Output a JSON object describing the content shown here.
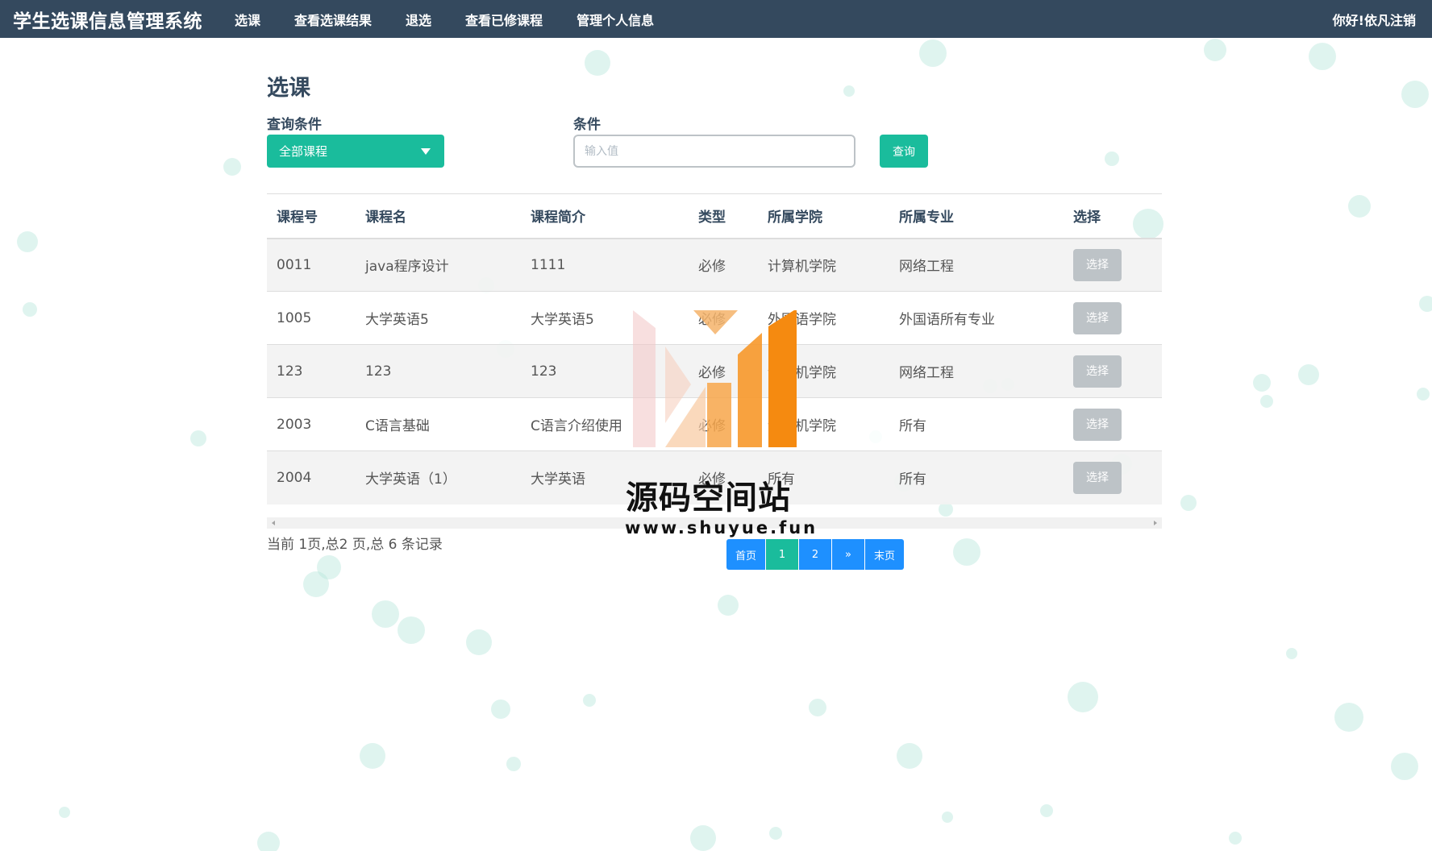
{
  "navbar": {
    "brand": "学生选课信息管理系统",
    "items": [
      {
        "label": "选课"
      },
      {
        "label": "查看选课结果"
      },
      {
        "label": "退选"
      },
      {
        "label": "查看已修课程"
      },
      {
        "label": "管理个人信息"
      }
    ],
    "greeting": "你好!",
    "user": "依凡",
    "logout": "注销"
  },
  "page": {
    "title": "选课"
  },
  "query": {
    "condition_label": "查询条件",
    "condition_value": "全部课程",
    "value_label": "条件",
    "value_placeholder": "输入值",
    "search_button": "查询"
  },
  "table": {
    "headers": [
      "课程号",
      "课程名",
      "课程简介",
      "类型",
      "所属学院",
      "所属专业",
      "选择"
    ],
    "rows": [
      {
        "id": "0011",
        "name": "java程序设计",
        "intro": "1111",
        "type": "必修",
        "college": "计算机学院",
        "major": "网络工程",
        "action": "选择"
      },
      {
        "id": "1005",
        "name": "大学英语5",
        "intro": "大学英语5",
        "type": "必修",
        "college": "外国语学院",
        "major": "外国语所有专业",
        "action": "选择"
      },
      {
        "id": "123",
        "name": "123",
        "intro": "123",
        "type": "必修",
        "college": "计算机学院",
        "major": "网络工程",
        "action": "选择"
      },
      {
        "id": "2003",
        "name": "C语言基础",
        "intro": "C语言介绍使用",
        "type": "必修",
        "college": "计算机学院",
        "major": "所有",
        "action": "选择"
      },
      {
        "id": "2004",
        "name": "大学英语（1）",
        "intro": "大学英语",
        "type": "必修",
        "college": "所有",
        "major": "所有",
        "action": "选择"
      }
    ]
  },
  "pagination": {
    "summary": "当前 1页,总2 页,总 6 条记录",
    "first": "首页",
    "pages": [
      "1",
      "2"
    ],
    "next": "»",
    "last": "末页",
    "current_page": 1
  },
  "watermark": {
    "title": "源码空间站",
    "url": "www.shuyue.fun"
  },
  "colors": {
    "navbar": "#34495e",
    "accent": "#1abc9c",
    "pager": "#1e90ff",
    "disabled_button": "#bdc3c7"
  }
}
